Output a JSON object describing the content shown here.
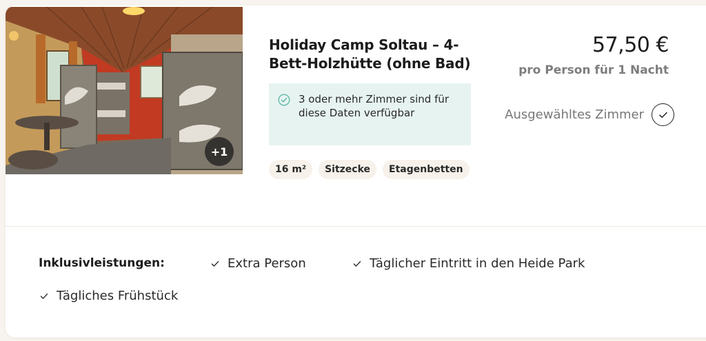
{
  "room": {
    "title": "Holiday Camp Soltau – 4-Bett-Holzhütte (ohne Bad)",
    "photo_badge": "+1",
    "availability": "3 oder mehr Zimmer sind für diese Daten verfügbar",
    "tags": [
      "16 m²",
      "Sitzecke",
      "Etagenbetten"
    ]
  },
  "pricing": {
    "price": "57,50 €",
    "unit": "pro Person für 1 Nacht",
    "selected_label": "Ausgewähltes Zimmer"
  },
  "inclusions": {
    "title": "Inklusivleistungen:",
    "items": [
      "Extra Person",
      "Täglicher Eintritt in den Heide Park",
      "Tägliches Frühstück"
    ]
  },
  "colors": {
    "availability_bg": "#e6f3f1",
    "availability_icon": "#5bb8a2",
    "tag_bg": "#f6f1ea",
    "muted_text": "#7d7d7d"
  },
  "icons": {
    "availability": "check-circle-icon",
    "selected": "check-circle-icon",
    "inclusion": "check-icon"
  }
}
